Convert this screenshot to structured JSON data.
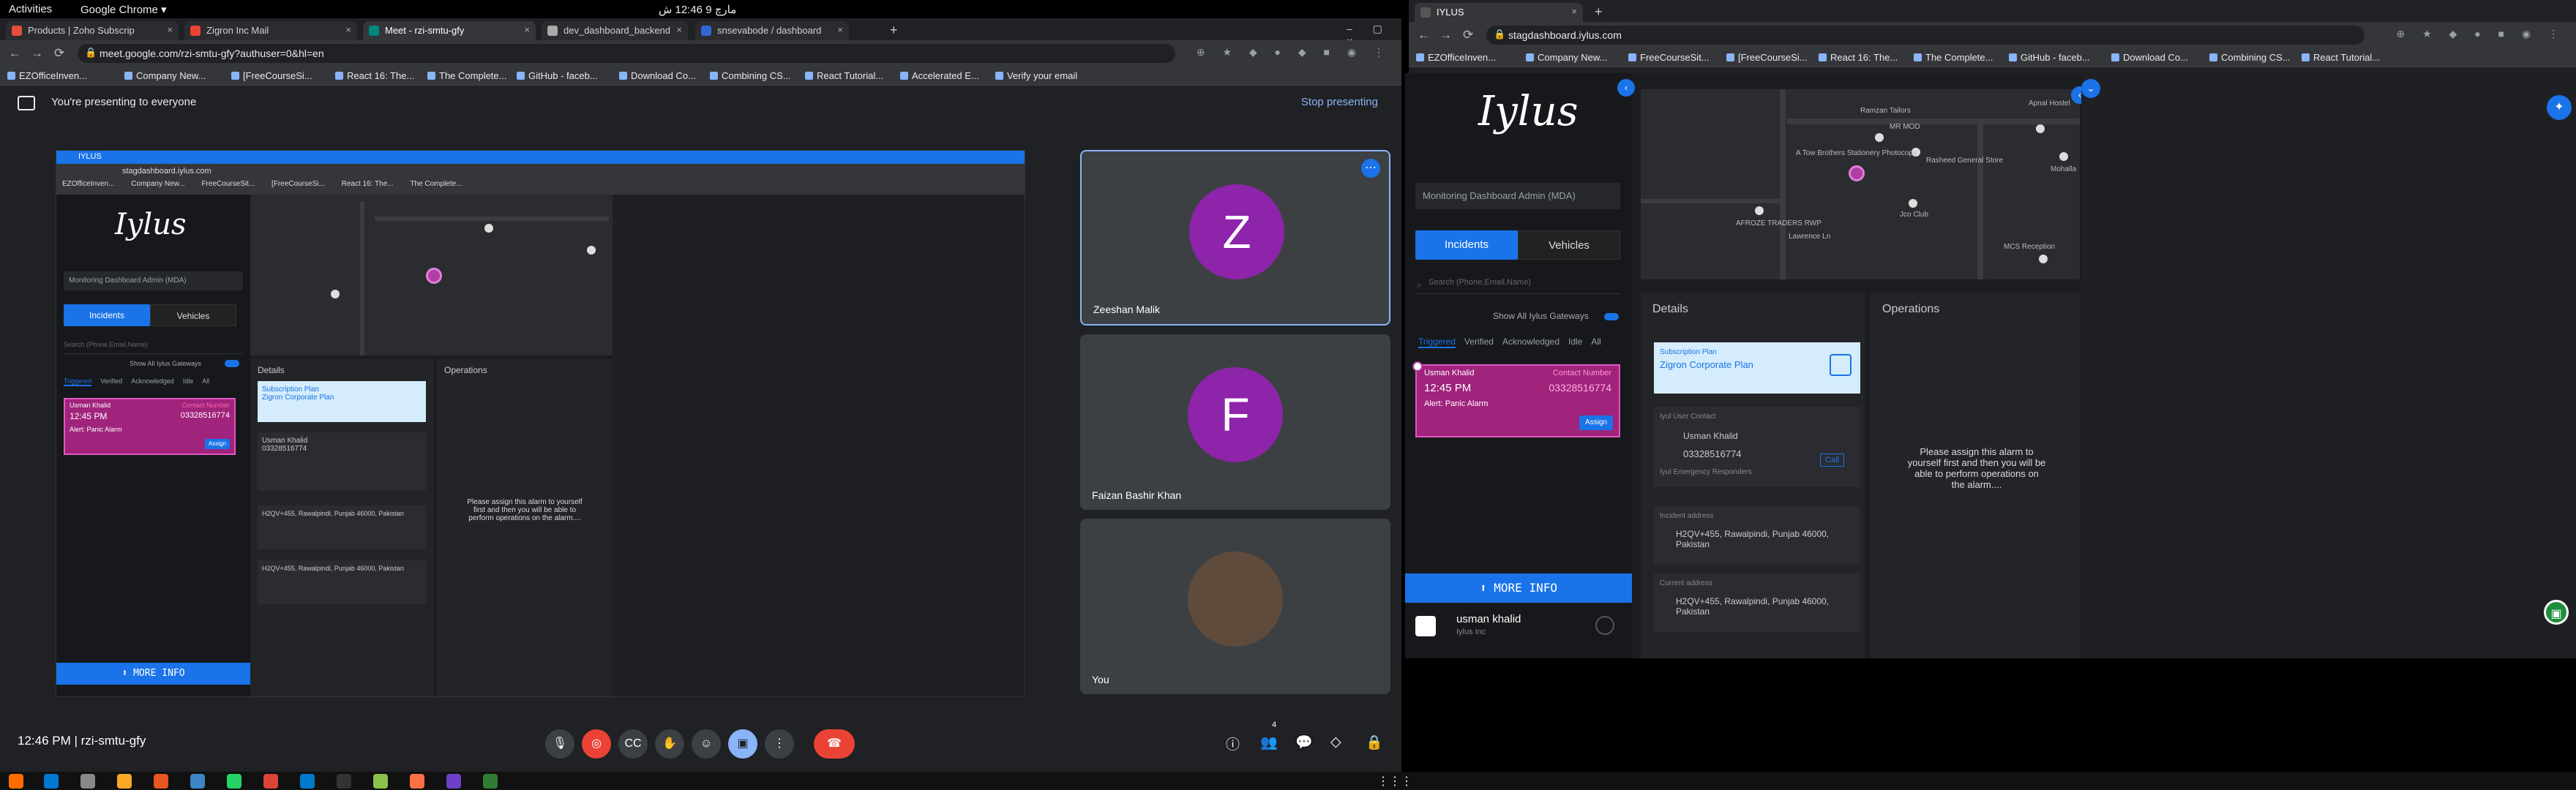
{
  "gnome": {
    "activities": "Activities",
    "app": "Google Chrome ▾",
    "clock": "مارچ 9  12:46 ش"
  },
  "left_window": {
    "tabs": [
      {
        "label": "Products | Zoho Subscrip",
        "color": "#e84c3d"
      },
      {
        "label": "Zigron Inc Mail",
        "color": "#ea4335"
      },
      {
        "label": "Meet - rzi-smtu-gfy",
        "color": "#00897b"
      },
      {
        "label": "dev_dashboard_backend",
        "color": "#aaaaaa"
      },
      {
        "label": "snsevabode / dashboard",
        "color": "#3367d6"
      }
    ],
    "url": "meet.google.com/rzi-smtu-gfy?authuser=0&hl=en",
    "bookmarks": [
      "EZOfficeInven...",
      "Company New...",
      "[FreeCourseSi...",
      "React 16: The...",
      "The Complete...",
      "GitHub - faceb...",
      "Download Co...",
      "Combining CS...",
      "React Tutorial...",
      "Accelerated E...",
      "Verify your email"
    ]
  },
  "meet": {
    "presenting_text": "You're presenting to everyone",
    "stop_label": "Stop presenting",
    "participants": [
      {
        "initial": "Z",
        "name": "Zeeshan Malik",
        "color": "#8e24aa"
      },
      {
        "initial": "F",
        "name": "Faizan Bashir Khan",
        "color": "#8e24aa"
      },
      {
        "initial": "",
        "name": "You",
        "color": "#5f4b3c"
      }
    ],
    "time_code": "12:46 PM  |  rzi-smtu-gfy",
    "people_count": "4"
  },
  "dashboard": {
    "tab_title": "IYLUS",
    "url": "stagdashboard.iylus.com",
    "bookmarks": [
      "EZOfficeInven...",
      "Company New...",
      "FreeCourseSit...",
      "[FreeCourseSi...",
      "React 16: The...",
      "The Complete...",
      "GitHub - faceb...",
      "Download Co...",
      "Combining CS...",
      "React Tutorial..."
    ],
    "logo": "Iylus",
    "mda_label": "Monitoring Dashboard Admin (MDA)",
    "incidents_label": "Incidents",
    "vehicles_label": "Vehicles",
    "search_placeholder": "Search (Phone,Email,Name)",
    "show_all": "Show All Iylus Gateways",
    "filters": [
      "Triggered",
      "Verified",
      "Acknowledged",
      "Idle",
      "All"
    ],
    "alarm": {
      "name": "Usman Khalid",
      "contact_label": "Contact Number",
      "time": "12:45 PM",
      "phone": "03328516774",
      "alert": "Alert: Panic Alarm",
      "assign": "Assign"
    },
    "more_info": "⬆ MORE INFO",
    "user_name": "usman khalid",
    "user_org": "Iylus Inc",
    "details_title": "Details",
    "operations_title": "Operations",
    "subscription_label": "Subscription Plan",
    "subscription_plan": "Zigron Corporate Plan",
    "user_contact_label": "Iyul User Contact",
    "contact_name": "Usman Khalid",
    "contact_phone": "03328516774",
    "call": "Call",
    "emergency_label": "Iyul Emergency Responders",
    "incident_address_label": "Incident address",
    "incident_address": "H2QV+455, Rawalpindi, Punjab 46000, Pakistan",
    "current_address_label": "Current address",
    "current_address": "H2QV+455, Rawalpindi, Punjab 46000, Pakistan",
    "assign_message": "Please assign this alarm to yourself first and then you will be able to perform operations on the alarm....",
    "map_labels": [
      "Ramzan Tailors",
      "Apnal Hostel",
      "MR MOD",
      "A Tow Brothers Stationery Photocopy",
      "Rasheed General Store",
      "Jco Club",
      "AFROZE TRADERS RWP",
      "Lawrence Ln",
      "MCS Reception",
      "Mohalla"
    ]
  }
}
